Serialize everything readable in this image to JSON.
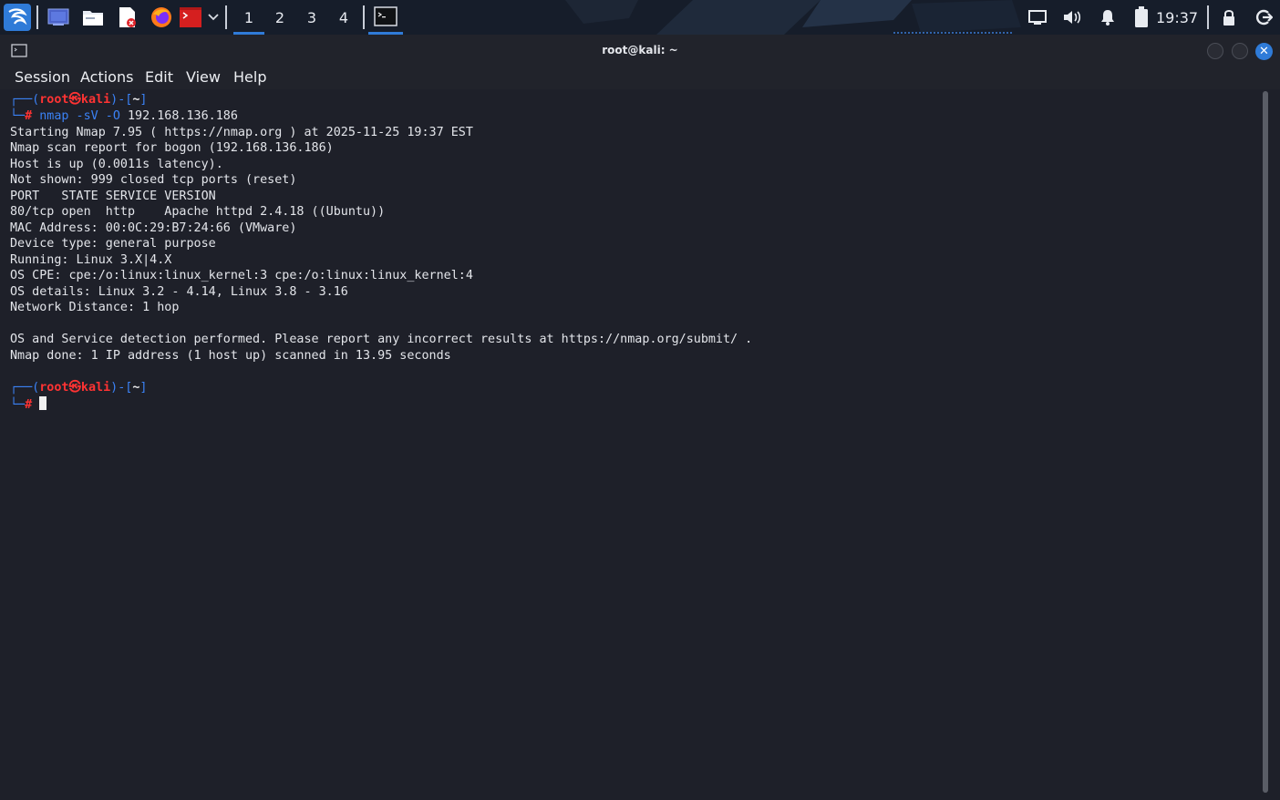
{
  "taskbar": {
    "workspaces": [
      "1",
      "2",
      "3",
      "4"
    ],
    "active_workspace": "1",
    "clock": "19:37",
    "icons": [
      "kali-menu-icon",
      "desktop-icon",
      "file-manager-icon",
      "text-editor-icon",
      "firefox-icon",
      "terminal-launcher-icon",
      "chevron-down-icon",
      "terminal-window-icon",
      "display-icon",
      "volume-icon",
      "bell-icon",
      "battery-icon",
      "lock-icon",
      "logout-icon"
    ],
    "accent": "#2f7bd8"
  },
  "window": {
    "title": "root@kali: ~",
    "menu": [
      "Session",
      "Actions",
      "Edit",
      "View",
      "Help"
    ]
  },
  "terminal": {
    "prompt1": {
      "bracket_open": "┌──(",
      "user": "root",
      "at": "㉿",
      "host": "kali",
      "bracket_mid": ")-[",
      "dir": "~",
      "bracket_close": "]",
      "corner": "└─",
      "hash": "#",
      "command": "nmap",
      "args": " -sV -O ",
      "target": "192.168.136.186"
    },
    "output": [
      "Starting Nmap 7.95 ( https://nmap.org ) at 2025-11-25 19:37 EST",
      "Nmap scan report for bogon (192.168.136.186)",
      "Host is up (0.0011s latency).",
      "Not shown: 999 closed tcp ports (reset)",
      "PORT   STATE SERVICE VERSION",
      "80/tcp open  http    Apache httpd 2.4.18 ((Ubuntu))",
      "MAC Address: 00:0C:29:B7:24:66 (VMware)",
      "Device type: general purpose",
      "Running: Linux 3.X|4.X",
      "OS CPE: cpe:/o:linux:linux_kernel:3 cpe:/o:linux:linux_kernel:4",
      "OS details: Linux 3.2 - 4.14, Linux 3.8 - 3.16",
      "Network Distance: 1 hop",
      "",
      "OS and Service detection performed. Please report any incorrect results at https://nmap.org/submit/ .",
      "Nmap done: 1 IP address (1 host up) scanned in 13.95 seconds"
    ],
    "prompt2": {
      "bracket_open": "┌──(",
      "user": "root",
      "at": "㉿",
      "host": "kali",
      "bracket_mid": ")-[",
      "dir": "~",
      "bracket_close": "]",
      "corner": "└─",
      "hash": "#"
    }
  }
}
